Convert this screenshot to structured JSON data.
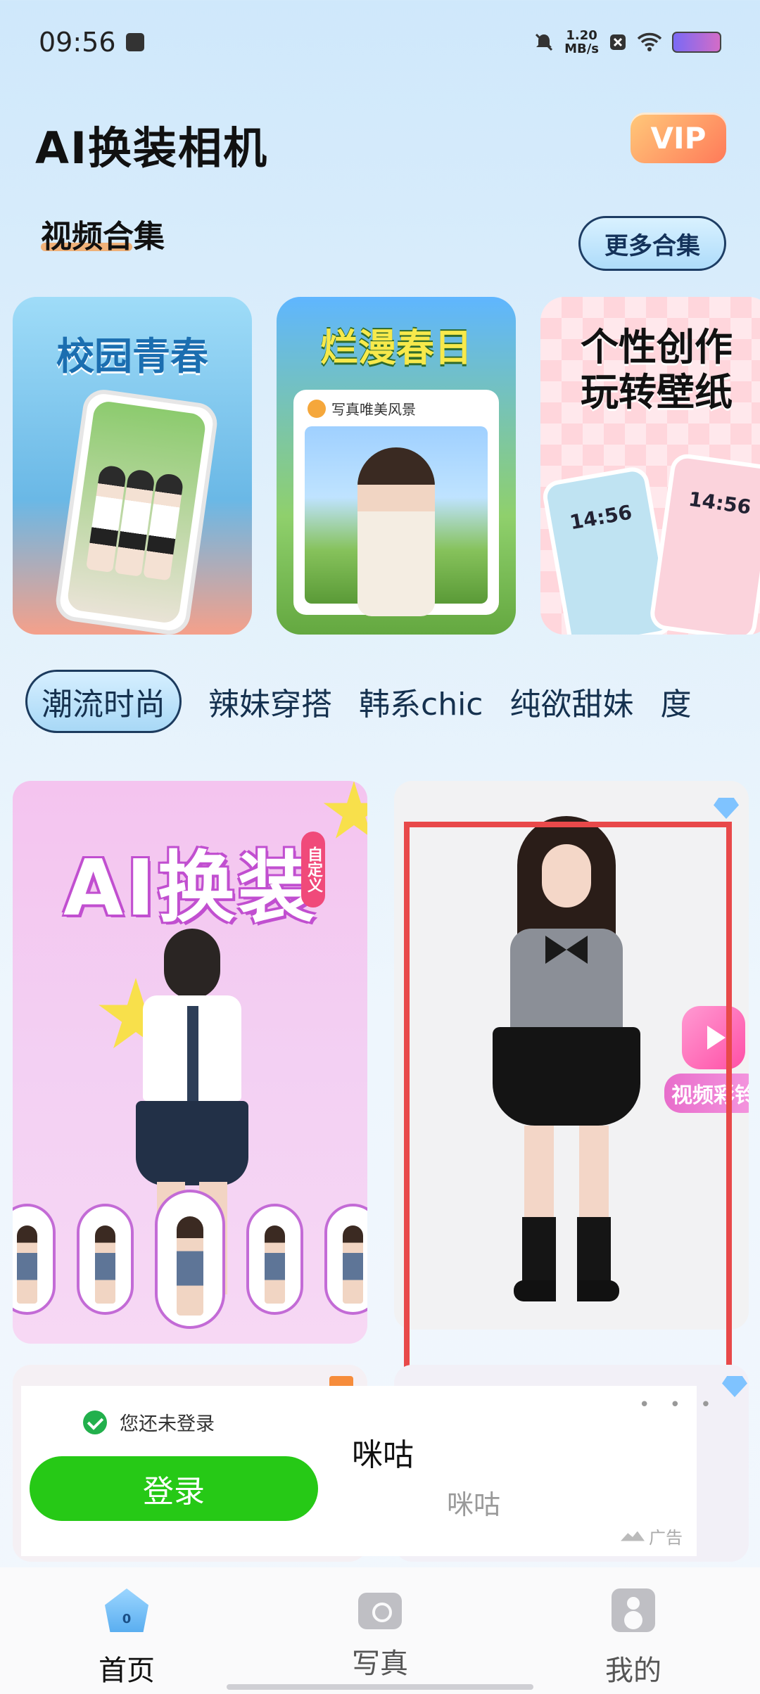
{
  "status_bar": {
    "time": "09:56",
    "speed_value": "1.20",
    "speed_unit": "MB/s"
  },
  "header": {
    "title": "AI换装相机",
    "vip_label": "VIP"
  },
  "collections_section": {
    "title": "视频合集",
    "more_label": "更多合集",
    "cards": [
      {
        "title": "校园青春"
      },
      {
        "title": "烂漫春日",
        "card_caption": "写真唯美风景"
      },
      {
        "title_line1": "个性创作",
        "title_line2": "玩转壁纸",
        "clock": "14:56"
      }
    ]
  },
  "category_tabs": [
    "潮流时尚",
    "辣妹穿搭",
    "韩系chic",
    "纯欲甜妹",
    "度"
  ],
  "feed": {
    "left_card": {
      "title": "AI换装",
      "tag": "自定义"
    },
    "right_card": {
      "badge": "视频彩铃",
      "more": "• • •"
    }
  },
  "login_banner": {
    "status_text": "您还未登录",
    "login_label": "登录",
    "ad_title": "咪咕",
    "ad_subtitle": "咪咕",
    "ad_mark": "广告"
  },
  "bottom_nav": [
    {
      "label": "首页",
      "icon": "home-icon",
      "badge": "0",
      "active": true
    },
    {
      "label": "写真",
      "icon": "camera-icon",
      "active": false
    },
    {
      "label": "我的",
      "icon": "profile-icon",
      "active": false
    }
  ]
}
